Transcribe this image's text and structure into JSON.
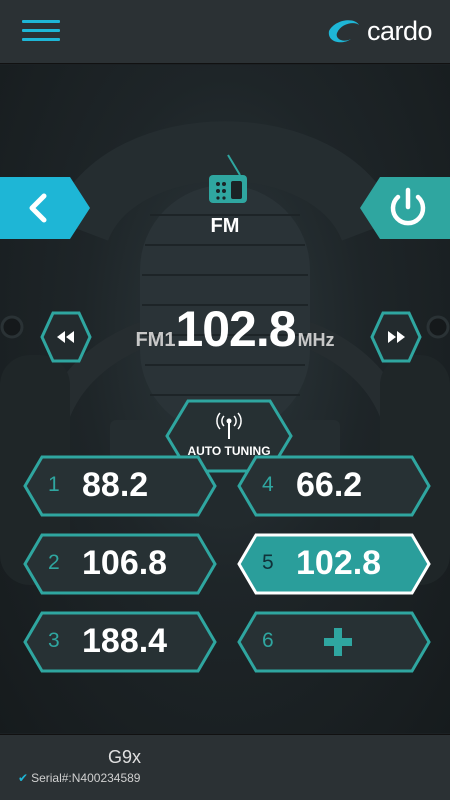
{
  "header": {
    "menu_icon": "hamburger-menu-icon",
    "brand": "cardo"
  },
  "screen": {
    "title": "FM",
    "icon": "radio-icon"
  },
  "nav": {
    "back_icon": "chevron-left-icon",
    "power_icon": "power-icon"
  },
  "tuner": {
    "band": "FM1",
    "frequency": "102.8",
    "unit": "MHz"
  },
  "seek": {
    "prev_icon": "rewind-icon",
    "next_icon": "fast-forward-icon"
  },
  "auto_tuning": {
    "label": "AUTO TUNING",
    "icon": "antenna-icon"
  },
  "stray_text": "4",
  "presets": [
    {
      "number": "1",
      "value": "88.2"
    },
    {
      "number": "4",
      "value": "66.2"
    },
    {
      "number": "2",
      "value": "106.8"
    },
    {
      "number": "5",
      "value": "102.8",
      "active": true
    },
    {
      "number": "3",
      "value": "188.4"
    },
    {
      "number": "6",
      "value": "",
      "icon": "plus-icon"
    }
  ],
  "footer": {
    "device": "G9x",
    "serial": "Serial#:N400234589"
  },
  "colors": {
    "accent": "#1eb6d6",
    "teal": "#2fa6a0",
    "active_fill": "#2a9e9b"
  }
}
